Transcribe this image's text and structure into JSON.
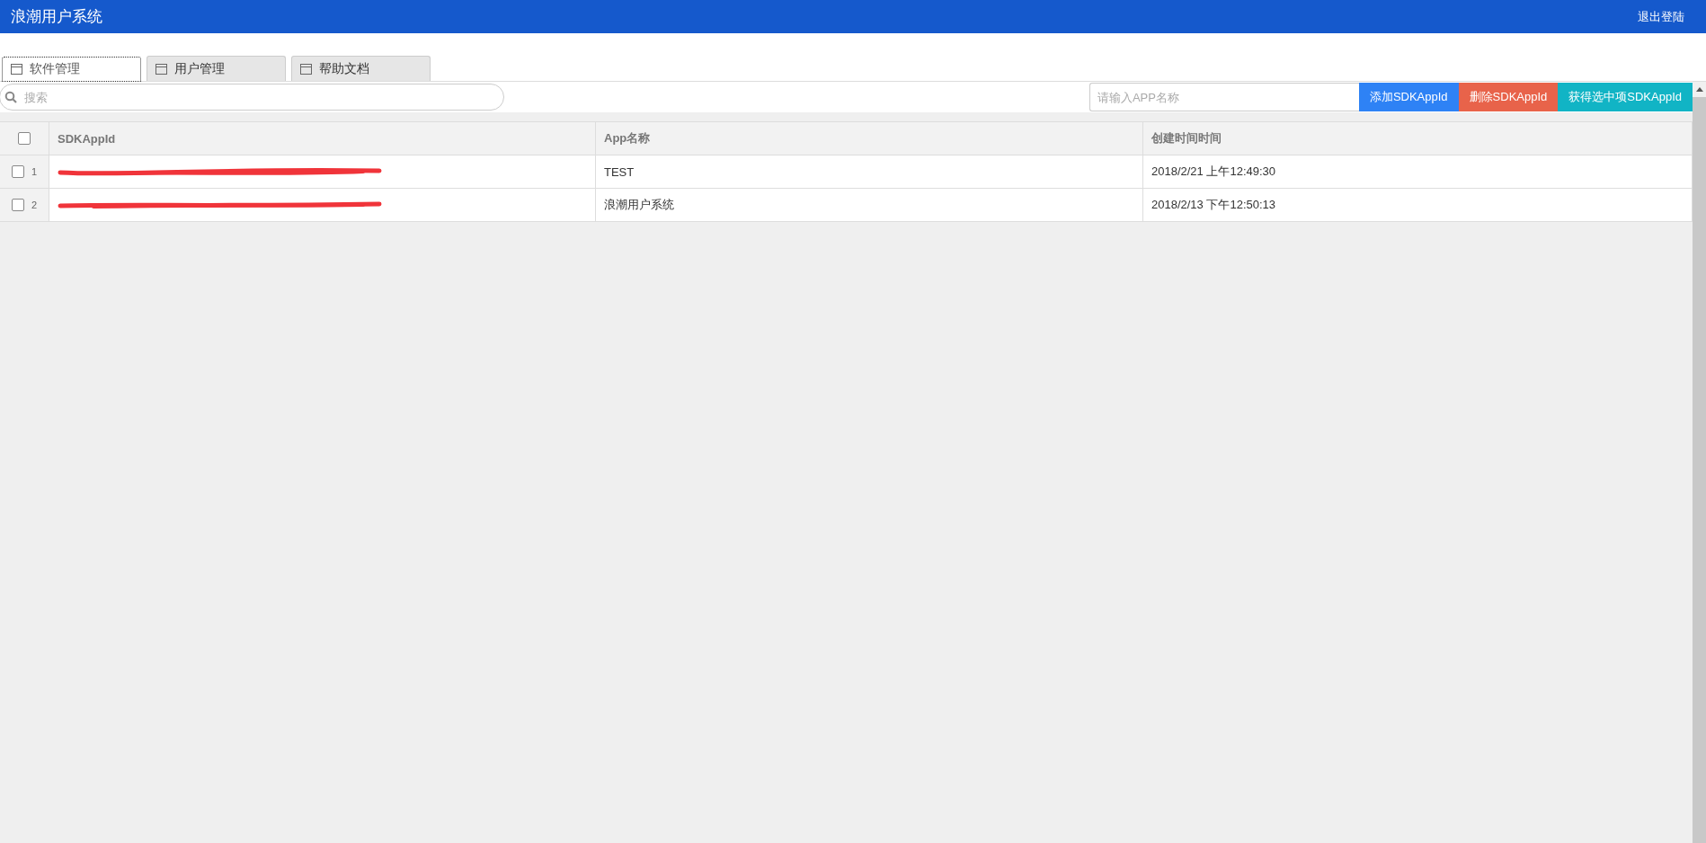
{
  "header": {
    "title": "浪潮用户系统",
    "logout": "退出登陆"
  },
  "tabs": [
    {
      "label": "软件管理",
      "selected": true
    },
    {
      "label": "用户管理",
      "selected": false
    },
    {
      "label": "帮助文档",
      "selected": false
    }
  ],
  "search": {
    "placeholder": "搜索"
  },
  "app_name_field": {
    "placeholder": "请输入APP名称"
  },
  "buttons": [
    {
      "label": "添加SDKAppId",
      "kind": "add"
    },
    {
      "label": "删除SDKAppId",
      "kind": "delete"
    },
    {
      "label": "获得选中项SDKAppId",
      "kind": "get"
    }
  ],
  "table": {
    "select_all_checked": false,
    "columns": [
      "SDKAppId",
      "App名称",
      "创建时间时间"
    ],
    "rows": [
      {
        "index": "1",
        "checked": false,
        "sdk_app_id_redacted": true,
        "app_name": "TEST",
        "created": "2018/2/21 上午12:49:30"
      },
      {
        "index": "2",
        "checked": false,
        "sdk_app_id_redacted": true,
        "app_name": "浪潮用户系统",
        "created": "2018/2/13 下午12:50:13"
      }
    ]
  }
}
